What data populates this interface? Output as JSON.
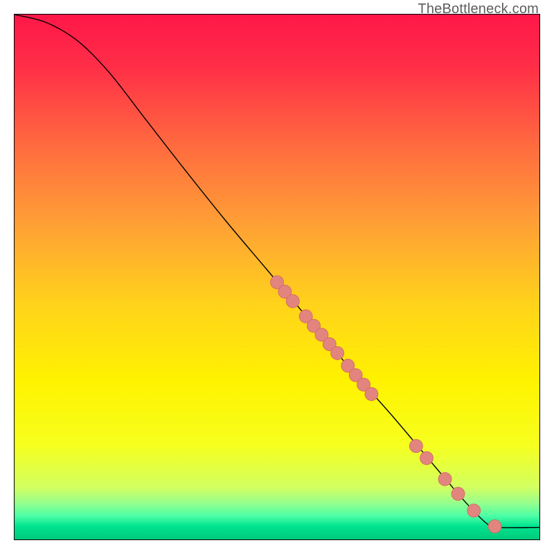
{
  "watermark": "TheBottleneck.com",
  "colors": {
    "curve": "#000000",
    "marker_fill": "#e2857e",
    "marker_stroke": "#d26b63",
    "frame": "#000000"
  },
  "chart_data": {
    "type": "line",
    "title": "",
    "xlabel": "",
    "ylabel": "",
    "xlim": [
      0,
      100
    ],
    "ylim": [
      0,
      100
    ],
    "grid": false,
    "legend": false,
    "curve": [
      {
        "x": 0,
        "y": 100
      },
      {
        "x": 6,
        "y": 98.5
      },
      {
        "x": 12,
        "y": 95
      },
      {
        "x": 18,
        "y": 89
      },
      {
        "x": 25,
        "y": 80
      },
      {
        "x": 32,
        "y": 71
      },
      {
        "x": 40,
        "y": 61
      },
      {
        "x": 48,
        "y": 51.5
      },
      {
        "x": 56,
        "y": 42
      },
      {
        "x": 64,
        "y": 32.5
      },
      {
        "x": 72,
        "y": 23.5
      },
      {
        "x": 80,
        "y": 14
      },
      {
        "x": 86,
        "y": 7
      },
      {
        "x": 90,
        "y": 3
      },
      {
        "x": 92,
        "y": 2.3
      },
      {
        "x": 100,
        "y": 2.3
      }
    ],
    "markers": [
      {
        "x": 50.0,
        "y": 49.0
      },
      {
        "x": 51.5,
        "y": 47.2
      },
      {
        "x": 53.0,
        "y": 45.4
      },
      {
        "x": 55.5,
        "y": 42.5
      },
      {
        "x": 57.0,
        "y": 40.7
      },
      {
        "x": 58.5,
        "y": 39.0
      },
      {
        "x": 60.0,
        "y": 37.2
      },
      {
        "x": 61.5,
        "y": 35.5
      },
      {
        "x": 63.5,
        "y": 33.1
      },
      {
        "x": 65.0,
        "y": 31.3
      },
      {
        "x": 66.5,
        "y": 29.5
      },
      {
        "x": 68.0,
        "y": 27.7
      },
      {
        "x": 76.5,
        "y": 17.8
      },
      {
        "x": 78.5,
        "y": 15.5
      },
      {
        "x": 82.0,
        "y": 11.5
      },
      {
        "x": 84.5,
        "y": 8.7
      },
      {
        "x": 87.5,
        "y": 5.5
      },
      {
        "x": 91.5,
        "y": 2.5
      }
    ],
    "background_gradient": {
      "type": "vertical",
      "stops": [
        {
          "pos": 0.0,
          "color": "#ff1749"
        },
        {
          "pos": 0.1,
          "color": "#ff2e47"
        },
        {
          "pos": 0.25,
          "color": "#ff6b3f"
        },
        {
          "pos": 0.4,
          "color": "#ffa035"
        },
        {
          "pos": 0.55,
          "color": "#ffd21b"
        },
        {
          "pos": 0.7,
          "color": "#fff300"
        },
        {
          "pos": 0.82,
          "color": "#f6ff1e"
        },
        {
          "pos": 0.9,
          "color": "#d3ff60"
        },
        {
          "pos": 0.93,
          "color": "#98ff8c"
        },
        {
          "pos": 0.955,
          "color": "#4cffa6"
        },
        {
          "pos": 0.975,
          "color": "#00e38f"
        },
        {
          "pos": 1.0,
          "color": "#00c97a"
        }
      ]
    }
  }
}
